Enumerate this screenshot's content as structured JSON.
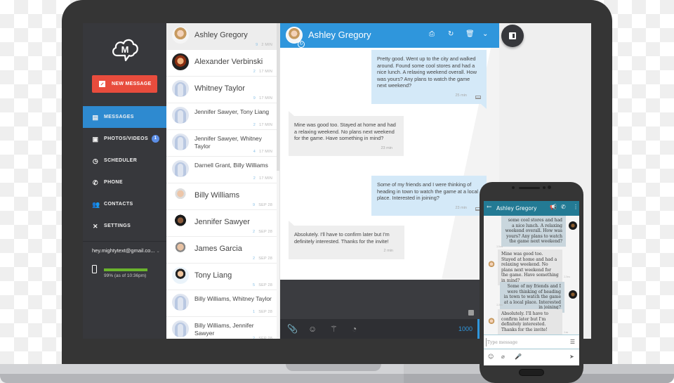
{
  "app": {
    "brand_icon": "mightytext-cloud-m-logo",
    "accent_color": "#2f96dc",
    "new_message_color": "#e84c3d"
  },
  "sidebar": {
    "new_message_label": "NEW MESSAGE",
    "items": [
      {
        "label": "MESSAGES",
        "icon": "messages-icon",
        "active": true
      },
      {
        "label": "PHOTOS/VIDEOS",
        "icon": "photos-icon",
        "badge": "1"
      },
      {
        "label": "SCHEDULER",
        "icon": "scheduler-icon"
      },
      {
        "label": "PHONE",
        "icon": "phone-icon"
      },
      {
        "label": "CONTACTS",
        "icon": "contacts-icon"
      },
      {
        "label": "SETTINGS",
        "icon": "settings-icon"
      }
    ],
    "account": "hey.mightytext@gmail.co...",
    "battery": {
      "percent": 99,
      "text": "99% (as of 10:36pm)"
    }
  },
  "conversations": [
    {
      "name": "Ashley Gregory",
      "count": "9",
      "time": "2 MIN",
      "active": true
    },
    {
      "name": "Alexander Verbinski",
      "count": "2",
      "time": "17 MIN"
    },
    {
      "name": "Whitney Taylor",
      "count": "9",
      "time": "17 MIN"
    },
    {
      "name": "Jennifer Sawyer, Tony Liang",
      "count": "2",
      "time": "17 MIN"
    },
    {
      "name": "Jennifer Sawyer, Whitney Taylor",
      "count": "4",
      "time": "17 MIN"
    },
    {
      "name": "Darnell Grant, Billy Williams",
      "count": "2",
      "time": "17 MIN"
    },
    {
      "name": "Billy Williams",
      "count": "9",
      "time": "SEP 28"
    },
    {
      "name": "Jennifer Sawyer",
      "count": "2",
      "time": "SEP 28"
    },
    {
      "name": "James Garcia",
      "count": "2",
      "time": "SEP 28"
    },
    {
      "name": "Tony Liang",
      "count": "5",
      "time": "SEP 28"
    },
    {
      "name": "Billy Williams, Whitney Taylor",
      "count": "1",
      "time": "SEP 28"
    },
    {
      "name": "Billy Williams, Jennifer Sawyer",
      "count": "2",
      "time": "SEP 28"
    }
  ],
  "chat": {
    "contact_name": "Ashley Gregory",
    "header_actions": [
      "print-icon",
      "refresh-icon",
      "trash-icon",
      "chevron-down-icon"
    ],
    "messages": [
      {
        "direction": "out",
        "text": "Pretty good. Went up to the city and walked around. Found some cool stores and had a nice lunch. A relaxing weekend overall. How was yours? Any plans to watch the game next weekend?",
        "time": "25 min"
      },
      {
        "direction": "in",
        "text": "Mine was good too. Stayed at home and had a relaxing weekend. No plans next weekend for the game. Have something in mind?",
        "time": "23 min"
      },
      {
        "direction": "out",
        "text": "Some of my friends and I were thinking of heading in town to watch the game at a local place. Interested in joining?",
        "time": "23 min"
      },
      {
        "direction": "in",
        "text": "Absolutely. I'll have to confirm later but I'm definitely interested. Thanks for the invite!",
        "time": "2 min"
      }
    ],
    "composer_value": "",
    "char_counter": "1000",
    "toolbar": [
      "attach-icon",
      "emoji-icon",
      "magic-wand-icon",
      "clock-icon"
    ]
  },
  "phone": {
    "contact_name": "Ashley Gregory",
    "back_glyph": "←",
    "messages": [
      {
        "direction": "out",
        "text": "some cool stores and had a nice lunch. A relaxing weekend overall. How was yours? Any plans to watch the game next weekend?",
        "time": "25m"
      },
      {
        "direction": "in",
        "text": "Mine was good too.  Stayed at home and had a relaxing weekend.  No plans next weekend for the game.  Have something in mind?",
        "time": "23m"
      },
      {
        "direction": "out",
        "text": "Some of my friends and I were thinking of heading in town to watch the game at a local place. Interested in joining?",
        "time": "23m"
      },
      {
        "direction": "in",
        "text": "Absolutely. I'll have to confirm later but I'm definitely interested. Thanks for the invite!",
        "time": "2m"
      }
    ],
    "input_placeholder": "Type message"
  }
}
